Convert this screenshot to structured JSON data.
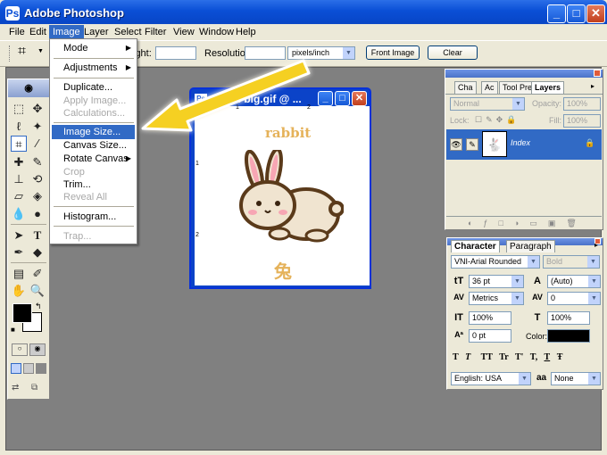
{
  "app": {
    "title": "Adobe Photoshop",
    "icon": "photoshop-app-icon",
    "window_buttons": [
      "_",
      "□",
      "✕"
    ]
  },
  "menubar": {
    "items": [
      "File",
      "Edit",
      "Image",
      "Layer",
      "Select",
      "Filter",
      "View",
      "Window",
      "Help"
    ],
    "active": "Image"
  },
  "options": {
    "height_label": "ight:",
    "height_value": "",
    "resolution_label": "Resolution:",
    "resolution_value": "",
    "units": "pixels/inch",
    "front_image": "Front Image",
    "clear": "Clear"
  },
  "image_menu": {
    "items": [
      {
        "label": "Mode",
        "submenu": true,
        "enabled": true
      },
      {
        "label": "Adjustments",
        "submenu": true,
        "enabled": true
      },
      {
        "label": "Duplicate...",
        "enabled": true
      },
      {
        "label": "Apply Image...",
        "enabled": false
      },
      {
        "label": "Calculations...",
        "enabled": false
      },
      {
        "label": "Image Size...",
        "enabled": true,
        "highlighted": true
      },
      {
        "label": "Canvas Size...",
        "enabled": true
      },
      {
        "label": "Rotate Canvas",
        "submenu": true,
        "enabled": true
      },
      {
        "label": "Crop",
        "enabled": false
      },
      {
        "label": "Trim...",
        "enabled": true
      },
      {
        "label": "Reveal All",
        "enabled": false
      },
      {
        "label": "Histogram...",
        "enabled": true
      },
      {
        "label": "Trap...",
        "enabled": false
      }
    ]
  },
  "document": {
    "title": "rabbit-big.gif @ ...",
    "image_caption": "rabbit",
    "image_glyph": "兔",
    "ruler_numbers": [
      "1",
      "2"
    ]
  },
  "layers_panel": {
    "tabs": [
      "Cha",
      "Ac",
      "Tool Pre",
      "Layers"
    ],
    "active_tab": "Layers",
    "blend_mode": "Normal",
    "opacity_label": "Opacity:",
    "opacity_value": "100%",
    "lock_label": "Lock:",
    "fill_label": "Fill:",
    "fill_value": "100%",
    "layer_name": "Index",
    "accent": "#316ac5"
  },
  "character_panel": {
    "tabs": [
      "Character",
      "Paragraph"
    ],
    "active_tab": "Character",
    "font_family": "VNI-Arial Rounded",
    "font_style": "Bold",
    "size": "36 pt",
    "leading": "(Auto)",
    "kerning": "Metrics",
    "tracking": "0",
    "vscale": "100%",
    "hscale": "100%",
    "baseline": "0 pt",
    "color_label": "Color:",
    "color_value": "#000000",
    "language": "English: USA",
    "antialias_label": "aa",
    "antialias": "None",
    "style_buttons": [
      "T",
      "T",
      "TT",
      "Tr",
      "T'",
      "T,",
      "T",
      "Ŧ"
    ]
  },
  "colors": {
    "foreground": "#000000",
    "background": "#ffffff",
    "highlight": "#316ac5",
    "caption": "#e5b25a"
  }
}
